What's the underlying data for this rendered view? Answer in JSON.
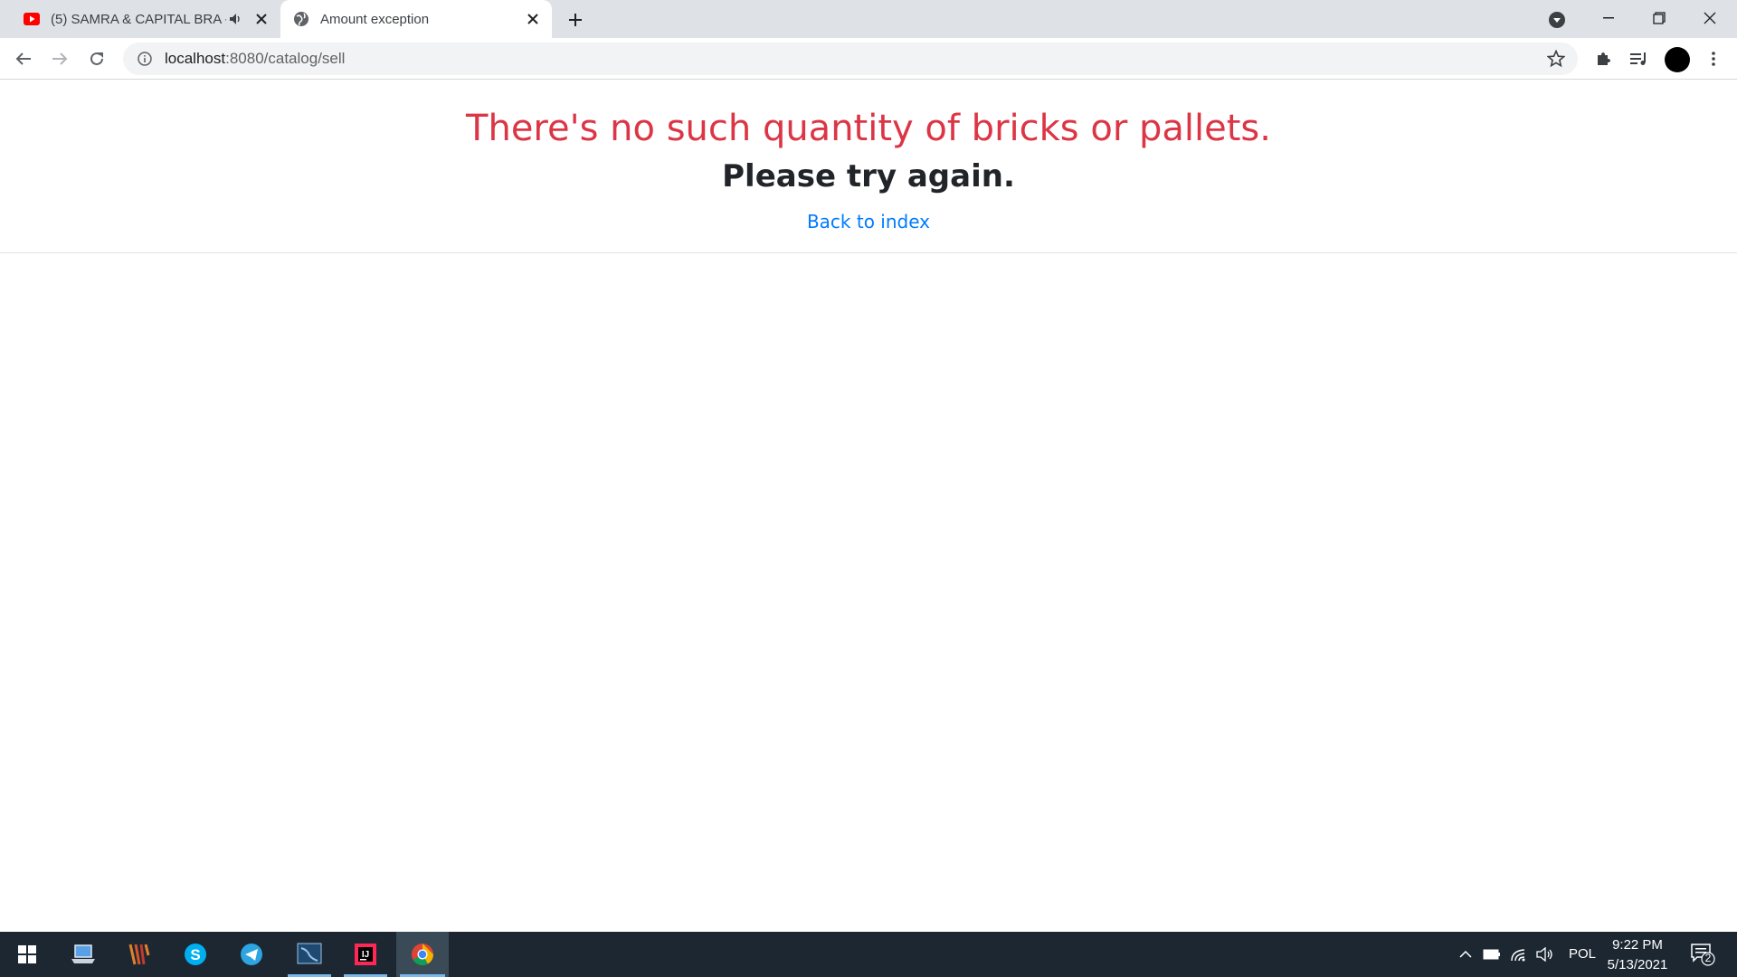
{
  "browser": {
    "tabs": [
      {
        "title": "(5) SAMRA & CAPITAL BRA -",
        "favicon": "youtube-icon",
        "audio": "audio-playing-icon",
        "active": false
      },
      {
        "title": "Amount exception",
        "favicon": "globe-icon",
        "active": true
      }
    ],
    "address": {
      "host": "localhost",
      "rest": ":8080/catalog/sell"
    }
  },
  "page": {
    "error_title": "There's no such quantity of bricks or pallets.",
    "error_subtitle": "Please try again.",
    "back_link": "Back to index"
  },
  "taskbar": {
    "language": "POL",
    "time": "9:22 PM",
    "date": "5/13/2021",
    "notifications": "2"
  },
  "colors": {
    "error_red": "#dc3545",
    "link_blue": "#007bff",
    "taskbar_bg": "#1c2732"
  }
}
